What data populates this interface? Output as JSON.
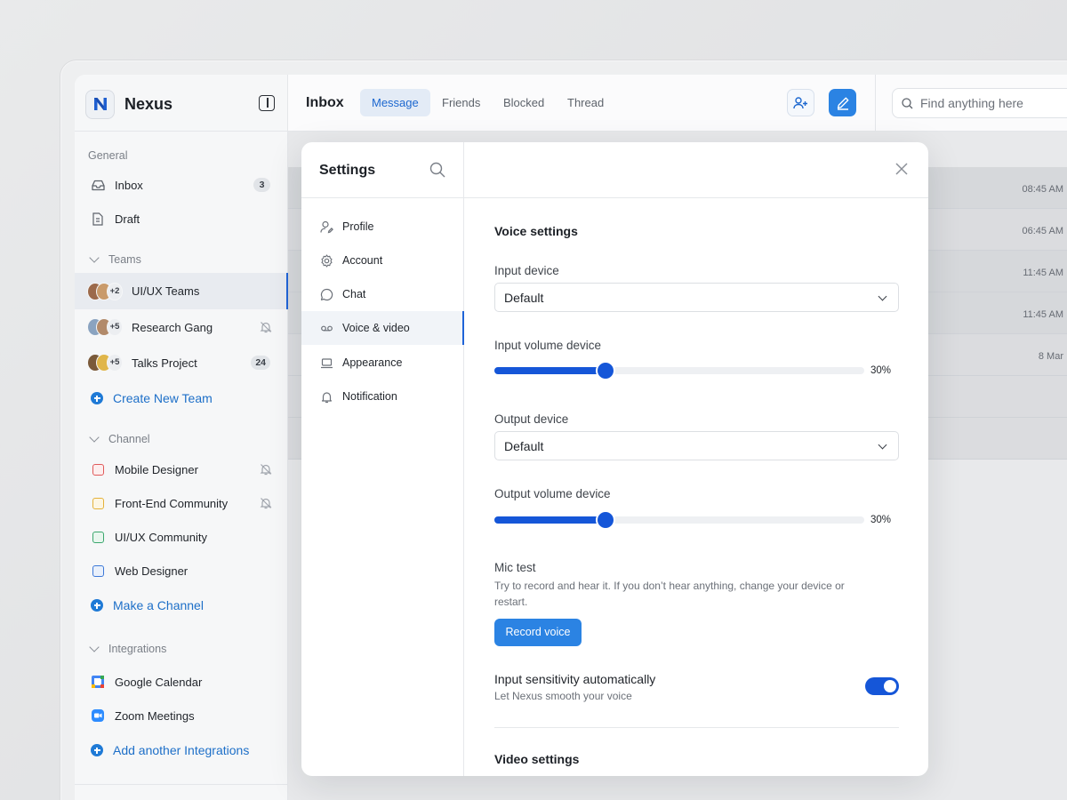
{
  "app": {
    "name": "Nexus"
  },
  "sidebar": {
    "general_label": "General",
    "general_items": [
      {
        "label": "Inbox",
        "badge": "3"
      },
      {
        "label": "Draft"
      }
    ],
    "teams_label": "Teams",
    "teams": [
      {
        "label": "UI/UX Teams",
        "more": "+2"
      },
      {
        "label": "Research Gang",
        "more": "+5"
      },
      {
        "label": "Talks Project",
        "more": "+5",
        "badge": "24"
      }
    ],
    "create_team": "Create New Team",
    "channel_label": "Channel",
    "channels": [
      {
        "label": "Mobile Designer",
        "color": "#e0595a"
      },
      {
        "label": "Front-End Community",
        "color": "#e4b23a"
      },
      {
        "label": "UI/UX Community",
        "color": "#3aa76d"
      },
      {
        "label": "Web Designer",
        "color": "#3c78d8"
      }
    ],
    "make_channel": "Make a Channel",
    "integrations_label": "Integrations",
    "integrations": [
      {
        "label": "Google Calendar"
      },
      {
        "label": "Zoom Meetings"
      }
    ],
    "add_integration": "Add another Integrations"
  },
  "topbar": {
    "title": "Inbox",
    "tabs": [
      "Message",
      "Friends",
      "Blocked",
      "Thread"
    ],
    "active_tab": "Message",
    "search_placeholder": "Find anything here"
  },
  "list": {
    "times": [
      "08:45 AM",
      "06:45 AM",
      "11:45 AM",
      "11:45 AM",
      "8 Mar"
    ]
  },
  "settings": {
    "title": "Settings",
    "menu": [
      "Profile",
      "Account",
      "Chat",
      "Voice & video",
      "Appearance",
      "Notification"
    ],
    "active": "Voice & video",
    "voice_heading": "Voice settings",
    "input_device_label": "Input device",
    "input_device_value": "Default",
    "input_volume_label": "Input volume device",
    "input_volume": 30,
    "input_volume_text": "30%",
    "output_device_label": "Output device",
    "output_device_value": "Default",
    "output_volume_label": "Output volume device",
    "output_volume": 30,
    "output_volume_text": "30%",
    "mic_test_title": "Mic test",
    "mic_test_desc": "Try to record and hear it. If you don’t hear anything, change your device or restart.",
    "record_button": "Record voice",
    "sensitivity_title": "Input sensitivity automatically",
    "sensitivity_desc": "Let Nexus smooth your voice",
    "sensitivity_on": true,
    "video_heading": "Video settings"
  },
  "colors": {
    "accent": "#1556d8",
    "button": "#2b83e3",
    "link": "#1d6fc8"
  }
}
